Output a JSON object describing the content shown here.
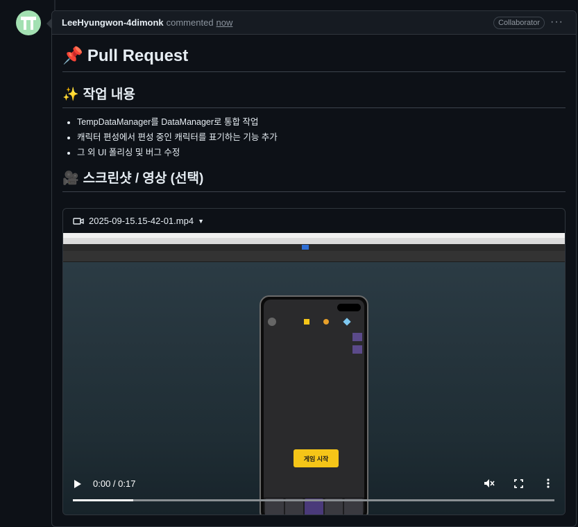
{
  "comment": {
    "author": "LeeHyungwon-4dimonk",
    "action": "commented",
    "time": "now",
    "role_badge": "Collaborator",
    "more_icon": "kebab-horizontal-icon"
  },
  "content": {
    "title_emoji": "📌",
    "title": "Pull Request",
    "section1_emoji": "✨",
    "section1_title": "작업 내용",
    "bullets": [
      "TempDataManager를 DataManager로 통합 작업",
      "캐릭터 편성에서 편성 중인 캐릭터를 표기하는 기능 추가",
      "그 외 UI 폴리싱 및 버그 수정"
    ],
    "section2_emoji": "🎥",
    "section2_title": "스크린샷 / 영상 (선택)"
  },
  "video": {
    "icon": "video-camera-icon",
    "filename": "2025-09-15.15-42-01.mp4",
    "current_time": "0:00 / 0:17",
    "progress": 0.125,
    "muted": true,
    "in_game_button": "게임 시작"
  },
  "colors": {
    "background": "#0d1117",
    "header_bg": "#161b22",
    "border": "#30363d",
    "text": "#e6edf3",
    "muted": "#8b949e",
    "game_button": "#f5c518"
  }
}
